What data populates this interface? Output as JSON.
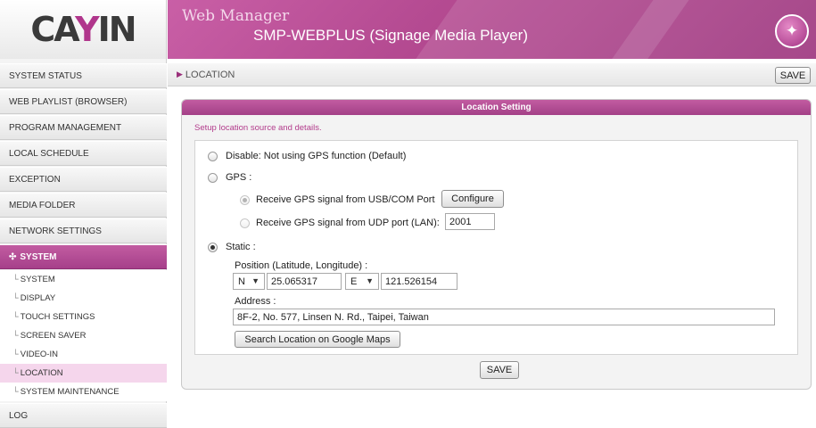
{
  "header": {
    "logo": "CAYIN",
    "title": "Web Manager",
    "subtitle": "SMP-WEBPLUS (Signage Media Player)",
    "badge_icon": "magic-wand-icon",
    "accent_color": "#b0368c"
  },
  "sidebar": {
    "menu": [
      {
        "label": "SYSTEM STATUS"
      },
      {
        "label": "WEB PLAYLIST (BROWSER)"
      },
      {
        "label": "PROGRAM MANAGEMENT"
      },
      {
        "label": "LOCAL SCHEDULE"
      },
      {
        "label": "EXCEPTION"
      },
      {
        "label": "MEDIA FOLDER"
      },
      {
        "label": "NETWORK SETTINGS"
      },
      {
        "label": "SYSTEM"
      }
    ],
    "submenu": [
      {
        "label": "SYSTEM"
      },
      {
        "label": "DISPLAY"
      },
      {
        "label": "TOUCH SETTINGS"
      },
      {
        "label": "SCREEN SAVER"
      },
      {
        "label": "VIDEO-IN"
      },
      {
        "label": "LOCATION"
      },
      {
        "label": "SYSTEM MAINTENANCE"
      }
    ],
    "log_label": "LOG"
  },
  "page": {
    "breadcrumb": "LOCATION",
    "save_label": "SAVE"
  },
  "panel": {
    "header": "Location Setting",
    "description": "Setup location source and details.",
    "option_disable": "Disable: Not using GPS function (Default)",
    "option_gps": "GPS :",
    "gps_usb": "Receive GPS signal from USB/COM Port",
    "configure_label": "Configure",
    "gps_udp": "Receive GPS signal from UDP port (LAN):",
    "udp_port": "2001",
    "option_static": "Static :",
    "position_label": "Position (Latitude, Longitude) :",
    "lat_dir": "N",
    "lat_value": "25.065317",
    "lon_dir": "E",
    "lon_value": "121.526154",
    "address_label": "Address :",
    "address_value": "8F-2, No. 577, Linsen N. Rd., Taipei, Taiwan",
    "search_label": "Search Location on Google Maps",
    "save_label": "SAVE"
  }
}
